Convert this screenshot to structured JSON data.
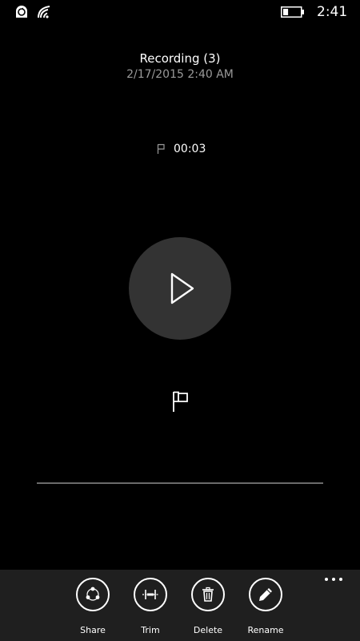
{
  "status_bar": {
    "time": "2:41",
    "battery_level": 0.3,
    "icons": [
      "sync-icon",
      "wifi-icon",
      "battery-icon"
    ]
  },
  "recording": {
    "title": "Recording (3)",
    "date": "2/17/2015 2:40 AM",
    "marker_time": "00:03",
    "progress": 0.0
  },
  "player": {
    "play_icon": "play-icon",
    "marker_icon": "flag-icon"
  },
  "app_bar": {
    "more_icon": "more-icon",
    "actions": [
      {
        "label": "Share",
        "icon": "share-icon"
      },
      {
        "label": "Trim",
        "icon": "trim-icon"
      },
      {
        "label": "Delete",
        "icon": "trash-icon"
      },
      {
        "label": "Rename",
        "icon": "pencil-icon"
      }
    ]
  },
  "colors": {
    "background": "#000000",
    "play_button": "#333333",
    "app_bar": "#1f1f1f",
    "secondary_text": "#9a9a9a",
    "track": "#6a6a6a"
  }
}
